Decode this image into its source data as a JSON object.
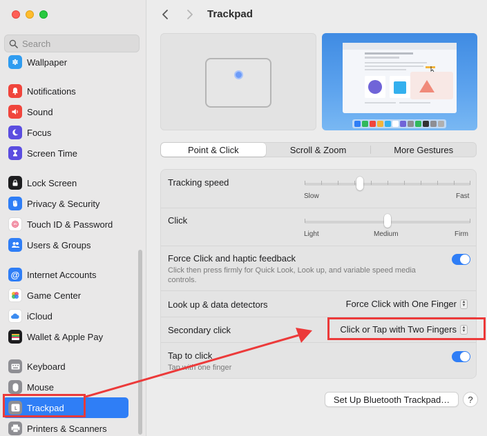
{
  "window": {
    "title": "Trackpad"
  },
  "search": {
    "placeholder": "Search"
  },
  "sidebar": {
    "items": [
      {
        "label": "Wallpaper",
        "icon": "wallpaper-icon",
        "color": "#2f9cf0"
      },
      {
        "label": "Notifications",
        "icon": "bell-icon",
        "color": "#f0453c"
      },
      {
        "label": "Sound",
        "icon": "speaker-icon",
        "color": "#f0453c"
      },
      {
        "label": "Focus",
        "icon": "moon-icon",
        "color": "#5b4de0"
      },
      {
        "label": "Screen Time",
        "icon": "hourglass-icon",
        "color": "#5b4de0"
      },
      {
        "label": "Lock Screen",
        "icon": "lock-icon",
        "color": "#1d1d1f"
      },
      {
        "label": "Privacy & Security",
        "icon": "hand-icon",
        "color": "#2f7ef6"
      },
      {
        "label": "Touch ID & Password",
        "icon": "fingerprint-icon",
        "color": "#ffffff"
      },
      {
        "label": "Users & Groups",
        "icon": "users-icon",
        "color": "#2f7ef6"
      },
      {
        "label": "Internet Accounts",
        "icon": "at-icon",
        "color": "#2f7ef6"
      },
      {
        "label": "Game Center",
        "icon": "game-center-icon",
        "color": "#ffffff"
      },
      {
        "label": "iCloud",
        "icon": "cloud-icon",
        "color": "#ffffff"
      },
      {
        "label": "Wallet & Apple Pay",
        "icon": "wallet-icon",
        "color": "#1d1d1f"
      },
      {
        "label": "Keyboard",
        "icon": "keyboard-icon",
        "color": "#8e8e93"
      },
      {
        "label": "Mouse",
        "icon": "mouse-icon",
        "color": "#8e8e93"
      },
      {
        "label": "Trackpad",
        "icon": "trackpad-icon",
        "color": "#8e8e93"
      },
      {
        "label": "Printers & Scanners",
        "icon": "printer-icon",
        "color": "#8e8e93"
      }
    ],
    "active": "Trackpad"
  },
  "tabs": [
    "Point & Click",
    "Scroll & Zoom",
    "More Gestures"
  ],
  "settings": {
    "tracking_speed": {
      "label": "Tracking speed",
      "min_label": "Slow",
      "max_label": "Fast",
      "value": 0.4
    },
    "click": {
      "label": "Click",
      "left_label": "Light",
      "mid_label": "Medium",
      "right_label": "Firm",
      "value": 0.5
    },
    "force_click": {
      "label": "Force Click and haptic feedback",
      "description": "Click then press firmly for Quick Look, Look up, and variable speed media controls.",
      "enabled": true
    },
    "look_up": {
      "label": "Look up & data detectors",
      "value": "Force Click with One Finger"
    },
    "secondary_click": {
      "label": "Secondary click",
      "value": "Click or Tap with Two Fingers"
    },
    "tap_to_click": {
      "label": "Tap to click",
      "description": "Tap with one finger",
      "enabled": true
    }
  },
  "footer": {
    "bluetooth_button": "Set Up Bluetooth Trackpad…",
    "help": "?"
  },
  "colors": {
    "accent": "#2f7ef6",
    "annotation": "#ec3a3a"
  }
}
